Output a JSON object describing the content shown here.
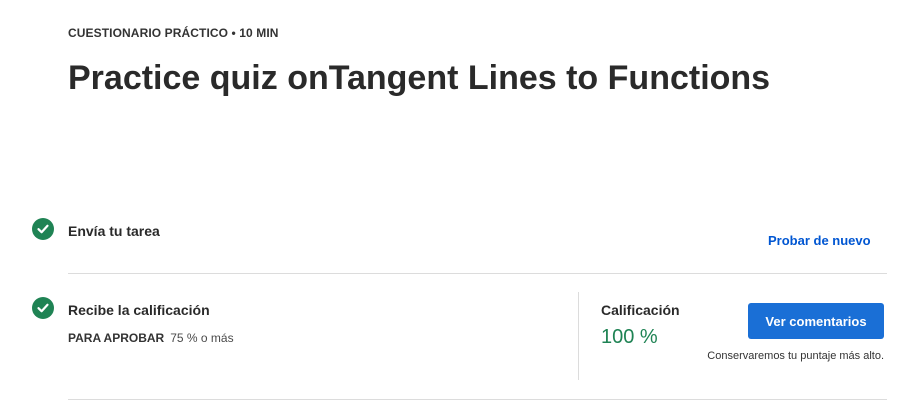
{
  "header": {
    "eyebrow": "CUESTIONARIO PRÁCTICO • 10 MIN",
    "title": "Practice quiz onTangent Lines to Functions"
  },
  "steps": [
    {
      "icon": "check-circle-icon",
      "label": "Envía tu tarea",
      "action_label": "Probar de nuevo"
    },
    {
      "icon": "check-circle-icon",
      "label": "Recibe la calificación",
      "pass_label": "PARA APROBAR",
      "pass_value": "75 % o más"
    }
  ],
  "grade": {
    "label": "Calificación",
    "value": "100 %",
    "button_label": "Ver comentarios",
    "note": "Conservaremos tu puntaje más alto."
  },
  "colors": {
    "success": "#1f8354",
    "link": "#0056d2",
    "button": "#1a6fd6"
  }
}
